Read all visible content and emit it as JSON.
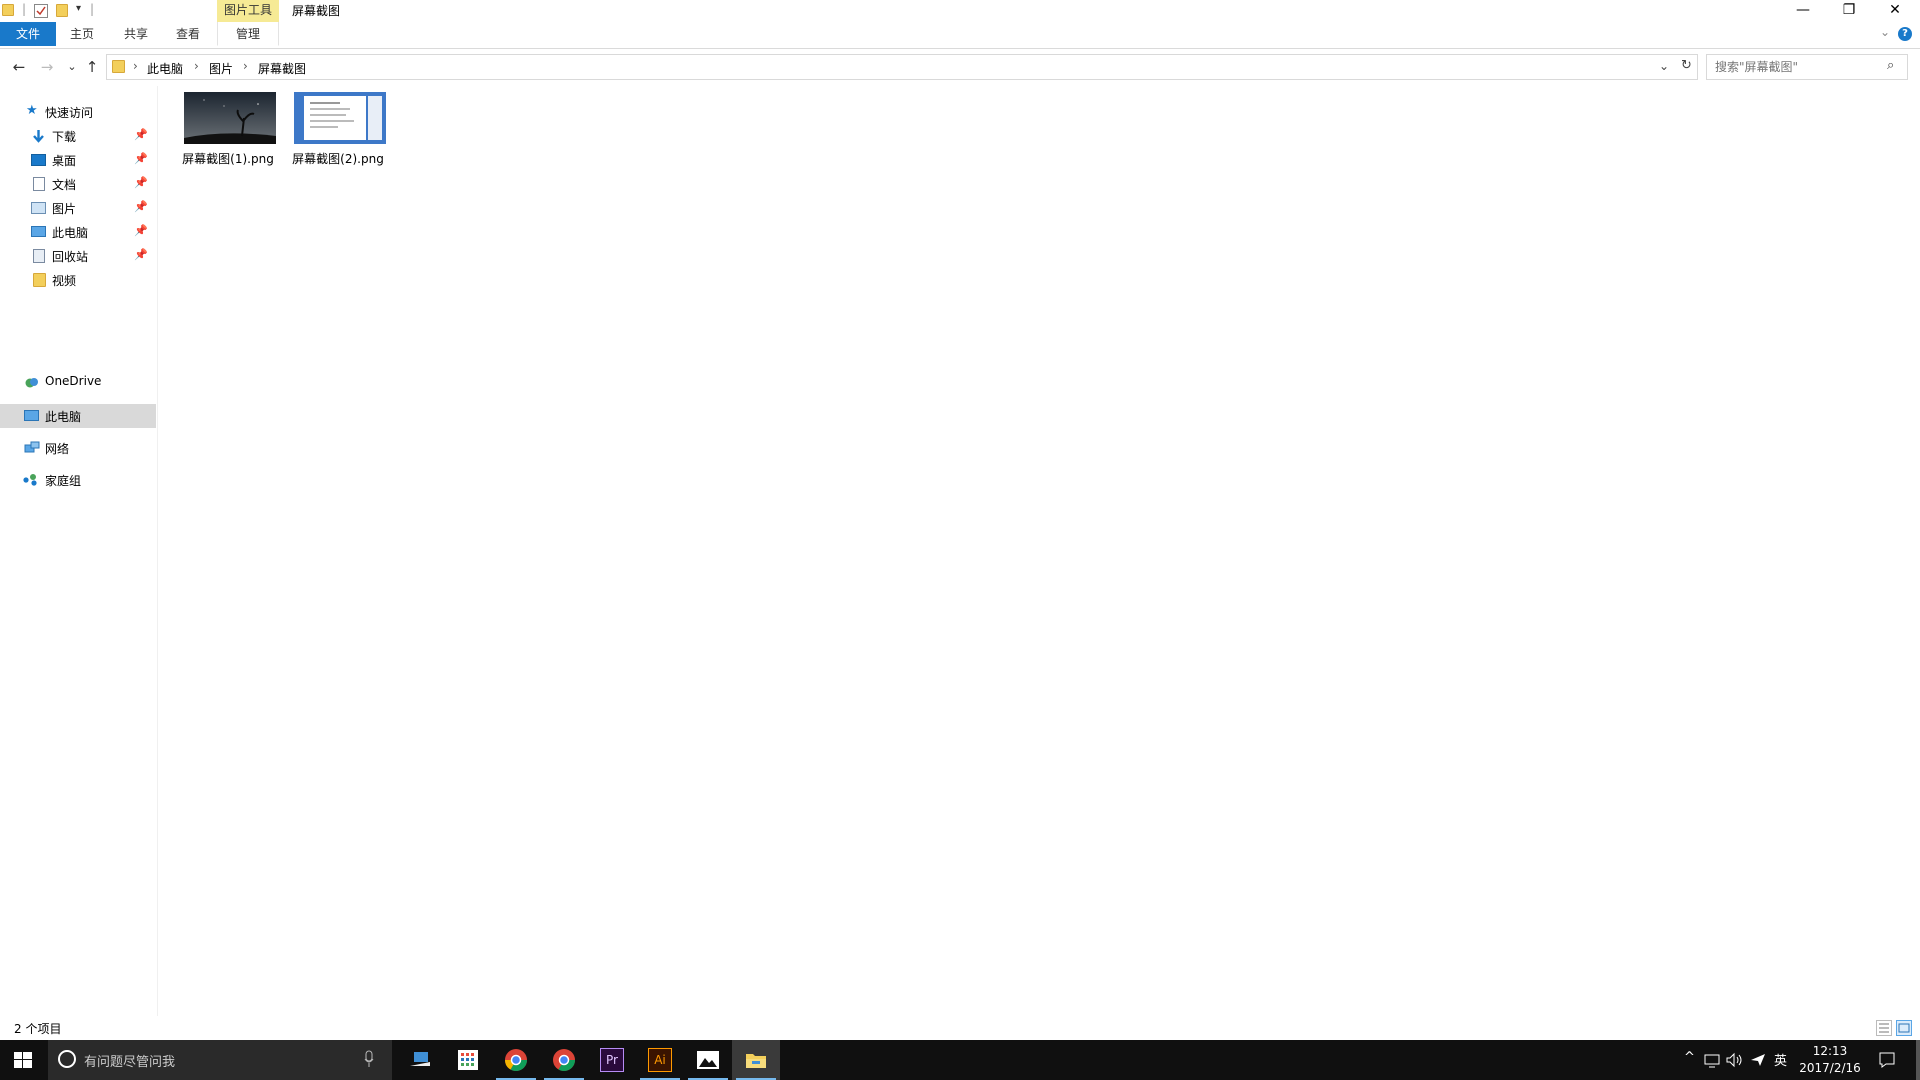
{
  "window": {
    "title": "屏幕截图",
    "context_tab": "图片工具",
    "min_glyph": "—",
    "max_glyph": "❐",
    "close_glyph": "✕"
  },
  "ribbon": {
    "tabs": [
      "文件",
      "主页",
      "共享",
      "查看",
      "管理"
    ],
    "collapse_glyph": "⌄",
    "help_glyph": "?"
  },
  "address": {
    "crumbs": [
      "此电脑",
      "图片",
      "屏幕截图"
    ],
    "separator": "›",
    "search_placeholder": "搜索\"屏幕截图\""
  },
  "nav_glyphs": {
    "back": "←",
    "forward": "→",
    "recent": "⌄",
    "up": "↑",
    "dropdown": "⌄",
    "refresh": "↻",
    "search": "⌕",
    "pin": "📌"
  },
  "sidebar": {
    "quick_access": "快速访问",
    "quick_items": [
      {
        "label": "下载",
        "icon": "download-icon",
        "pinned": true
      },
      {
        "label": "桌面",
        "icon": "desktop-icon",
        "pinned": true
      },
      {
        "label": "文档",
        "icon": "documents-icon",
        "pinned": true
      },
      {
        "label": "图片",
        "icon": "pictures-icon",
        "pinned": true
      },
      {
        "label": "此电脑",
        "icon": "computer-icon",
        "pinned": true
      },
      {
        "label": "回收站",
        "icon": "recycle-bin-icon",
        "pinned": true
      },
      {
        "label": "视频",
        "icon": "folder-icon",
        "pinned": false
      }
    ],
    "roots": [
      {
        "label": "OneDrive",
        "icon": "onedrive-icon",
        "selected": false
      },
      {
        "label": "此电脑",
        "icon": "computer-icon",
        "selected": true
      },
      {
        "label": "网络",
        "icon": "network-icon",
        "selected": false
      },
      {
        "label": "家庭组",
        "icon": "homegroup-icon",
        "selected": false
      }
    ]
  },
  "files": [
    {
      "name": "屏幕截图(1).png",
      "thumb": "night-sky"
    },
    {
      "name": "屏幕截图(2).png",
      "thumb": "screenshot-doc"
    }
  ],
  "status": {
    "item_count": "2 个项目"
  },
  "taskbar": {
    "search_text": "有问题尽管问我",
    "apps": [
      "file-explorer-alt",
      "store",
      "chrome",
      "chrome-alt",
      "premiere",
      "illustrator",
      "photos",
      "file-explorer"
    ],
    "app_labels": {
      "premiere": "Pr",
      "illustrator": "Ai"
    },
    "tray": {
      "chevron": "^",
      "lang": "英"
    },
    "time": "12:13",
    "date": "2017/2/16"
  },
  "colors": {
    "accent": "#1979ca",
    "context_tab": "#f6ea95",
    "taskbar": "#101010",
    "selected_nav": "#d9d9d9"
  }
}
